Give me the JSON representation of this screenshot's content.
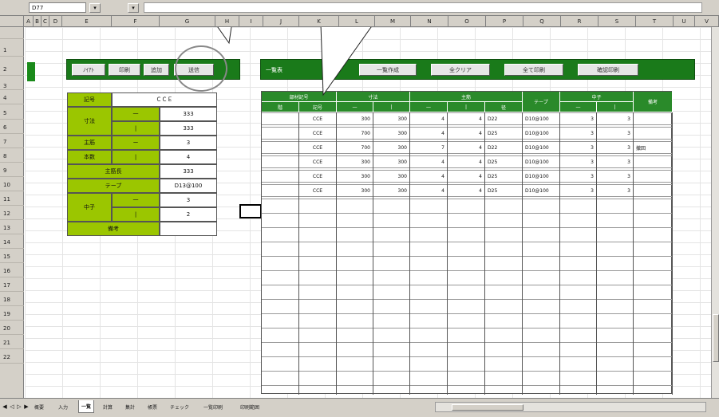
{
  "toolbar": {
    "name_box": "D77",
    "btn_a": "▾",
    "btn_b": "▾"
  },
  "column_headers": [
    "A",
    "B",
    "C",
    "D",
    "E",
    "F",
    "G",
    "H",
    "I",
    "J",
    "K",
    "L",
    "M",
    "N",
    "O",
    "P",
    "Q",
    "R",
    "S",
    "T",
    "U",
    "V"
  ],
  "row_headers": [
    "",
    "1",
    "2",
    "3",
    "4",
    "5",
    "6",
    "7",
    "8",
    "9",
    "10",
    "11",
    "12",
    "13",
    "14",
    "15",
    "16",
    "17",
    "18",
    "19",
    "20",
    "21",
    "22"
  ],
  "input_panel": {
    "buttons": [
      "ﾉｲｱﾄ",
      "印刷",
      "追加",
      "送信"
    ],
    "labels": {
      "code": "記号",
      "size": "寸法",
      "main": "主筋",
      "count": "本数",
      "main_length": "主筋長",
      "tape": "テープ",
      "hook": "中子",
      "note": "備考"
    },
    "sub_labels": {
      "a": "一",
      "b": "|",
      "c": "ー",
      "d": "|",
      "e": "一",
      "f": "|"
    },
    "values": {
      "code": "ＣＣＥ",
      "size_a": "333",
      "size_b": "333",
      "main_a": "3",
      "main_b": "4",
      "main_length": "333",
      "tape": "D13@100",
      "hook_a": "3",
      "hook_b": "2",
      "note": ""
    }
  },
  "list_panel": {
    "title": "一覧表",
    "buttons": [
      "一覧作成",
      "全クリア",
      "全て印刷",
      "確認印刷"
    ],
    "headers": {
      "group1": "部材記号",
      "sub1a": "階",
      "sub1b": "記号",
      "group2": "寸法",
      "sub2a": "一",
      "sub2b": "|",
      "group3": "主筋",
      "sub3a": "一",
      "sub3b": "|",
      "sub3c": "径",
      "tape": "テープ",
      "group4": "中子",
      "sub4a": "一",
      "sub4b": "|",
      "note": "備考"
    },
    "rows": [
      [
        "",
        "CCE",
        "300",
        "300",
        "4",
        "4",
        "D22",
        "D10@100",
        "3",
        "3",
        ""
      ],
      [
        "",
        "CCE",
        "700",
        "300",
        "4",
        "4",
        "D25",
        "D10@100",
        "3",
        "3",
        ""
      ],
      [
        "",
        "CCE",
        "700",
        "300",
        "7",
        "4",
        "D22",
        "D10@100",
        "3",
        "3",
        "撤回"
      ],
      [
        "",
        "CCE",
        "300",
        "300",
        "4",
        "4",
        "D25",
        "D10@100",
        "3",
        "3",
        ""
      ],
      [
        "",
        "CCE",
        "300",
        "300",
        "4",
        "4",
        "D25",
        "D10@100",
        "3",
        "3",
        ""
      ],
      [
        "",
        "CCE",
        "300",
        "300",
        "4",
        "4",
        "D25",
        "D10@100",
        "3",
        "3",
        ""
      ]
    ]
  },
  "sheet_tabs": [
    "概要",
    "入力",
    "一覧",
    "計算",
    "集計",
    "帳票",
    "チェック",
    "一覧印刷",
    "印刷範囲"
  ],
  "colors": {
    "dark_green": "#1a7a1a",
    "light_green": "#9bc600",
    "header_green": "#2a8a2a",
    "chrome": "#d4d0c8"
  }
}
